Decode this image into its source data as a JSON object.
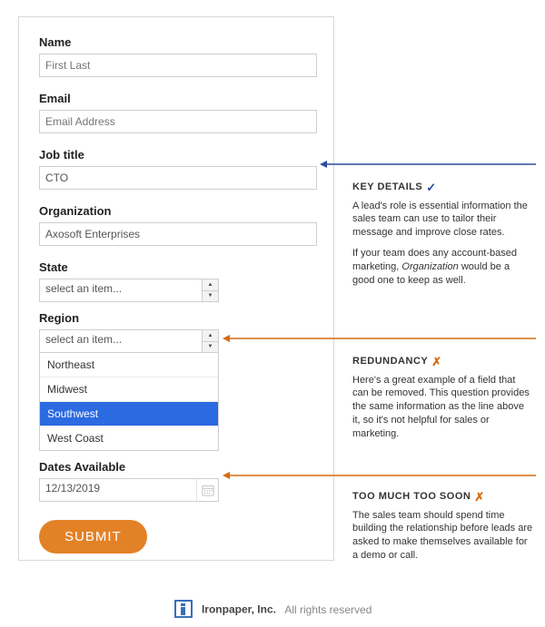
{
  "form": {
    "name": {
      "label": "Name",
      "placeholder": "First Last"
    },
    "email": {
      "label": "Email",
      "placeholder": "Email Address"
    },
    "job_title": {
      "label": "Job title",
      "value": "CTO"
    },
    "organization": {
      "label": "Organization",
      "value": "Axosoft Enterprises"
    },
    "state": {
      "label": "State",
      "placeholder": "select an item..."
    },
    "region": {
      "label": "Region",
      "placeholder": "select an item...",
      "options": [
        "Northeast",
        "Midwest",
        "Southwest",
        "West Coast"
      ],
      "selected_index": 2
    },
    "dates": {
      "label": "Dates Available",
      "value": "12/13/2019"
    },
    "submit": "SUBMIT"
  },
  "annotations": {
    "key_details": {
      "title": "KEY DETAILS",
      "p1": "A lead's role is essential information the sales team can use to tailor their message and improve close rates.",
      "p2_prefix": "If your team does any account-based marketing, ",
      "p2_em": "Organization",
      "p2_suffix": " would be a good one to keep as well."
    },
    "redundancy": {
      "title": "REDUNDANCY",
      "p1": "Here's a great example of a field that can be removed. This question provides the same information as the line above it, so it's not helpful for sales or marketing."
    },
    "too_much": {
      "title": "TOO MUCH TOO SOON",
      "p1": "The sales team should spend time building the relationship before leads are asked to make themselves available for a demo or call."
    }
  },
  "footer": {
    "brand": "Ironpaper, Inc.",
    "rights": "All rights reserved"
  }
}
